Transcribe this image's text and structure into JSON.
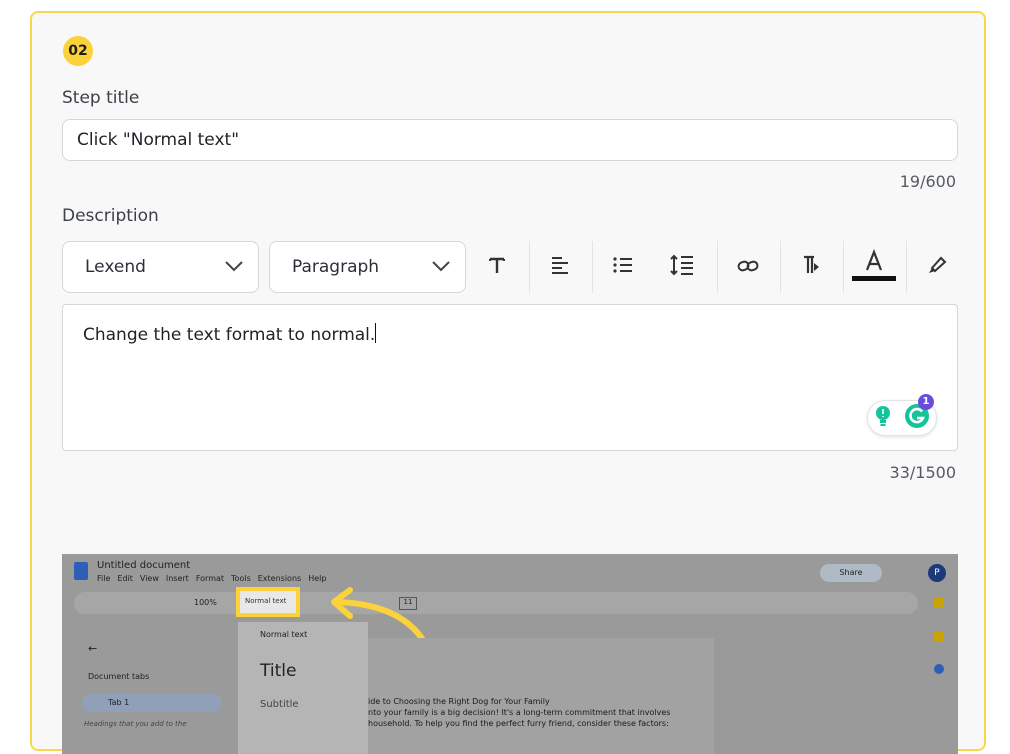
{
  "step": {
    "number": "02",
    "title_label": "Step title",
    "title_value": "Click \"Normal text\"",
    "title_counter": "19/600",
    "description_label": "Description",
    "description_text": "Change the text format to normal.",
    "description_counter": "33/1500"
  },
  "toolbar": {
    "font": "Lexend",
    "block_type": "Paragraph",
    "icons": [
      "text-size-icon",
      "align-left-icon",
      "bullet-list-icon",
      "line-height-icon",
      "link-icon",
      "clear-format-icon",
      "text-color-icon",
      "highlight-icon"
    ]
  },
  "grammarly": {
    "count": "1"
  },
  "screenshot": {
    "doc_title": "Untitled document",
    "menu": [
      "File",
      "Edit",
      "View",
      "Insert",
      "Format",
      "Tools",
      "Extensions",
      "Help"
    ],
    "zoom": "100%",
    "style_dropdown": "Normal text",
    "font_size": "11",
    "share": "Share",
    "avatar": "P",
    "sidebar_title": "Document tabs",
    "tab_name": "Tab 1",
    "sidebar_hint": "Headings that you add to the",
    "menu_items": [
      "Normal text",
      "Title",
      "Subtitle"
    ],
    "doc_lines": [
      "ide to Choosing the Right Dog for Your Family",
      "nto your family is a big decision!  It's a long-term commitment that involves",
      "household. To help you find the perfect furry friend, consider these factors:"
    ]
  },
  "colors": {
    "accent": "#f9d74a",
    "badge": "#fbd23a",
    "grammarly": "#15c39a"
  }
}
